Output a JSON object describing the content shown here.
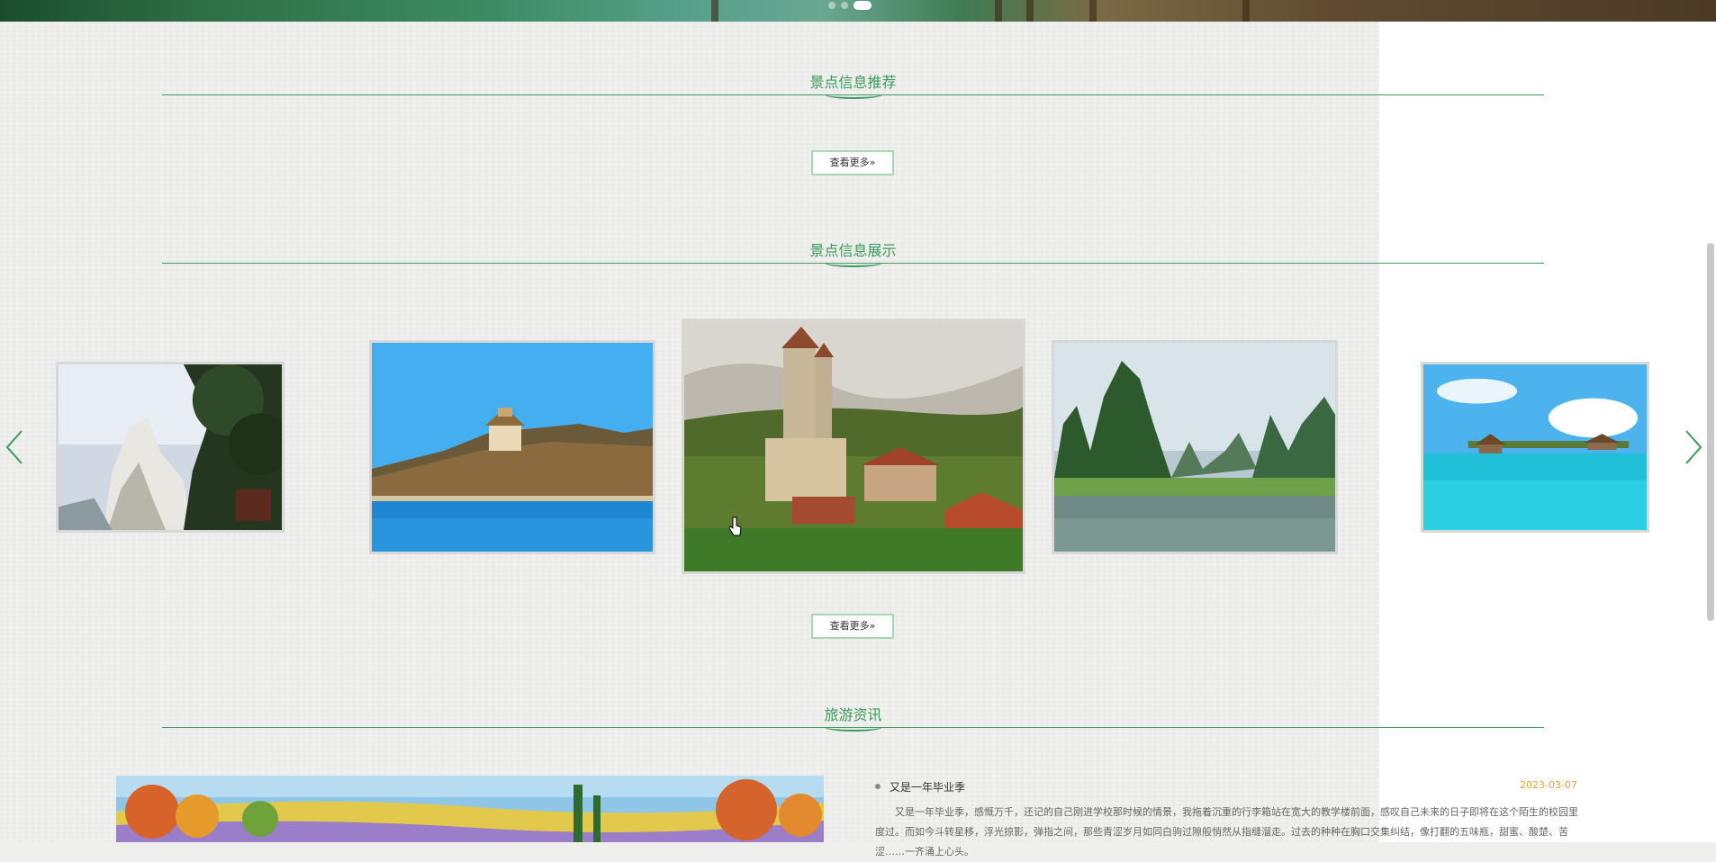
{
  "sections": {
    "recommend": {
      "title": "景点信息推荐",
      "more": "查看更多»"
    },
    "showcase": {
      "title": "景点信息展示",
      "more": "查看更多»"
    },
    "news": {
      "title": "旅游资讯"
    }
  },
  "carousel": {
    "slides": [
      {
        "name": "cliff-mountain"
      },
      {
        "name": "summer-palace-lake"
      },
      {
        "name": "castle-town"
      },
      {
        "name": "karst-river"
      },
      {
        "name": "tropical-resort"
      }
    ]
  },
  "news_item": {
    "title": "又是一年毕业季",
    "date": "2023-03-07",
    "body": "又是一年毕业季，感慨万千，还记的自己刚进学校那时候的情景，我拖着沉重的行李箱站在宽大的教学楼前面，感叹自己未来的日子即将在这个陌生的校园里度过。而如今斗转星移，浮光掠影，弹指之间，那些青涩岁月如同白驹过隙般悄然从指缝溜走。过去的种种在胸口交集纠结，像打翻的五味瓶，甜蜜、酸楚、苦涩……一齐涌上心头。"
  },
  "colors": {
    "accent": "#3a9a5a",
    "date": "#e6a43b"
  }
}
